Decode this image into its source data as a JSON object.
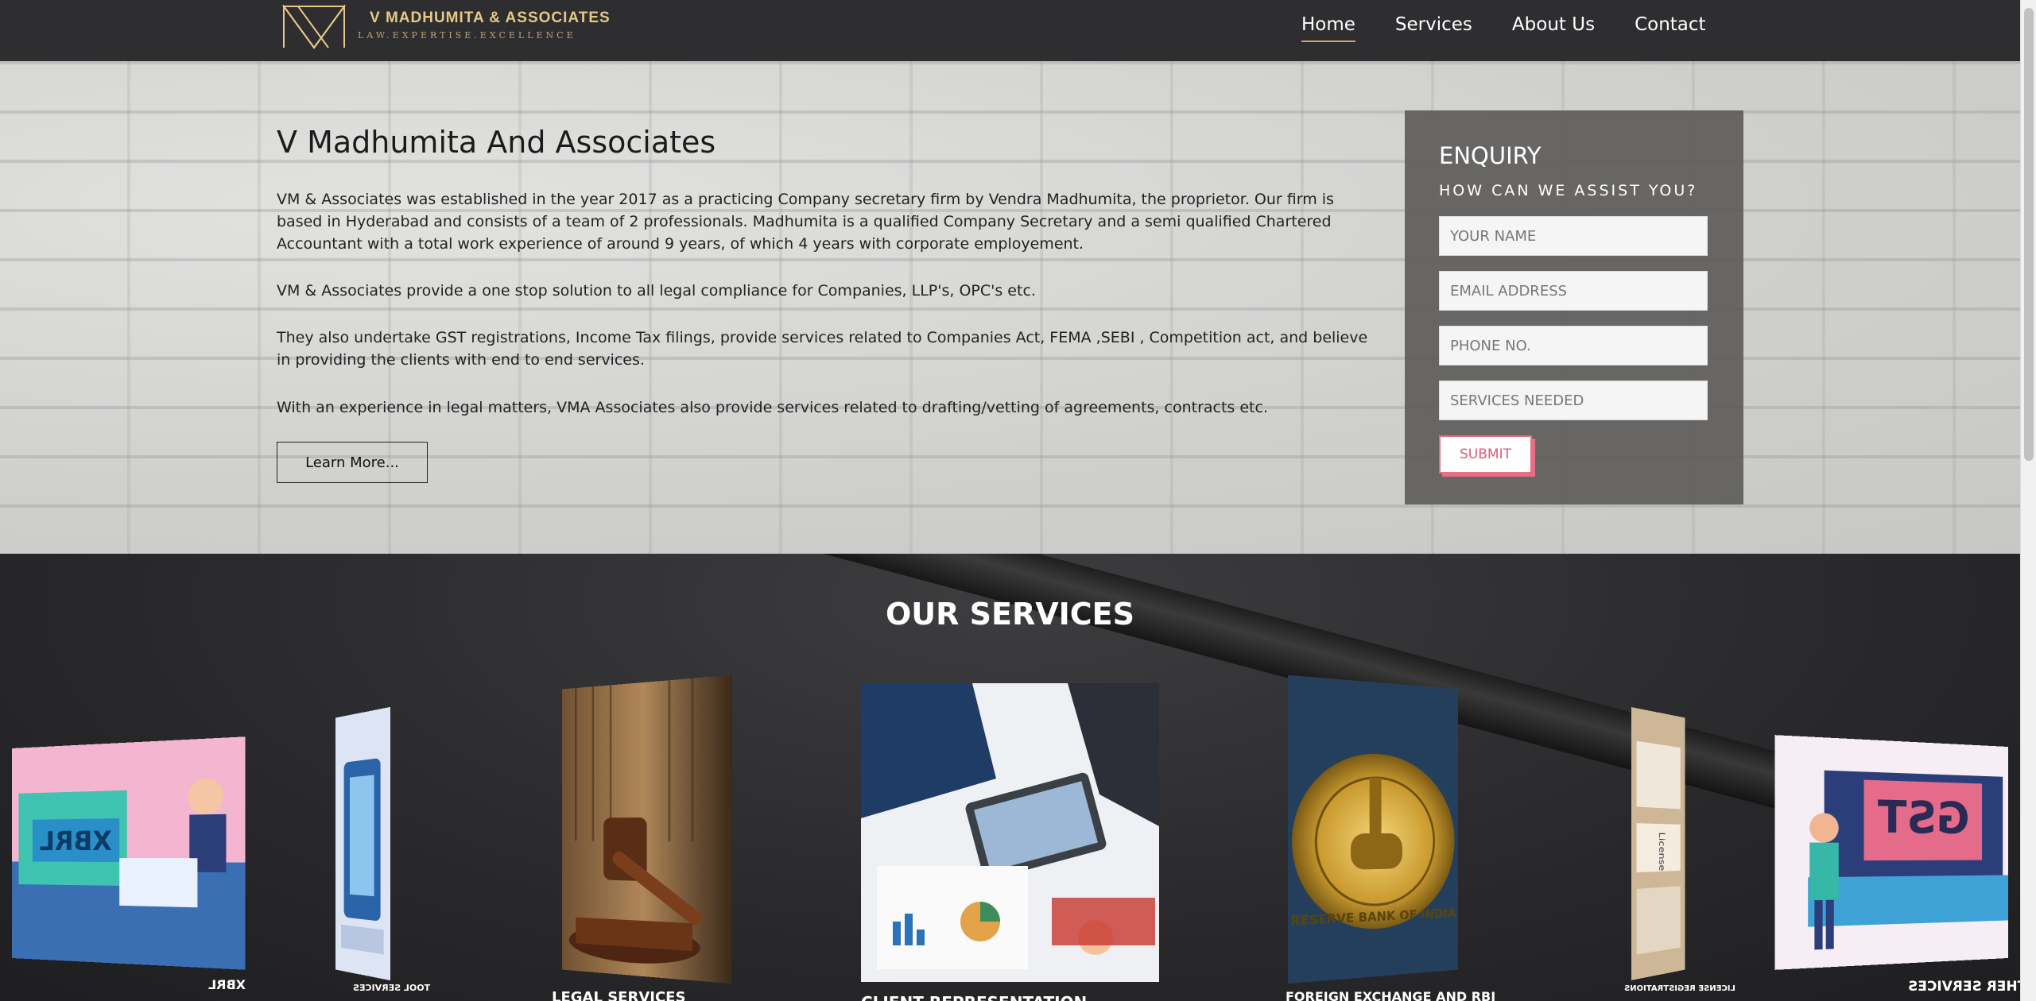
{
  "header": {
    "brand_title": "V MADHUMITA & ASSOCIATES",
    "brand_tagline": "LAW.EXPERTISE.EXCELLENCE",
    "nav": [
      {
        "label": "Home",
        "active": true
      },
      {
        "label": "Services",
        "active": false
      },
      {
        "label": "About Us",
        "active": false
      },
      {
        "label": "Contact",
        "active": false
      }
    ]
  },
  "hero": {
    "title": "V Madhumita And Associates",
    "paragraphs": [
      "VM & Associates was established in the year 2017 as a practicing Company secretary firm by Vendra Madhumita, the proprietor. Our firm is based in Hyderabad and consists of a team of 2 professionals. Madhumita is a qualified Company Secretary and a semi qualified Chartered Accountant with a total work experience of around 9 years, of which 4 years with corporate employement.",
      "VM & Associates provide a one stop solution to all legal compliance for Companies, LLP's, OPC's etc.",
      "They also undertake GST registrations, Income Tax filings, provide services related to Companies Act, FEMA ,SEBI , Competition act, and believe in providing the clients with end to end services.",
      "With an experience in legal matters, VMA Associates also provide services related to drafting/vetting of agreements, contracts etc."
    ],
    "learn_more_label": "Learn More..."
  },
  "enquiry": {
    "title": "ENQUIRY",
    "subtitle": "HOW CAN WE ASSIST YOU?",
    "fields": [
      {
        "placeholder": "YOUR NAME"
      },
      {
        "placeholder": "EMAIL ADDRESS"
      },
      {
        "placeholder": "PHONE NO."
      },
      {
        "placeholder": "SERVICES NEEDED"
      }
    ],
    "submit_label": "SUBMIT"
  },
  "services": {
    "heading": "OUR SERVICES",
    "cards": [
      {
        "caption": "XBRL",
        "image": "xbrl-illustration"
      },
      {
        "caption": "TOOL SERVICES",
        "image": "device-illustration"
      },
      {
        "caption": "LEGAL SERVICES",
        "image": "gavel-photo"
      },
      {
        "caption": "CLIENT REPRESENTATION",
        "image": "business-meeting-photo"
      },
      {
        "caption": "FOREIGN EXCHANGE AND RBI",
        "image": "rbi-seal-photo"
      },
      {
        "caption": "LICENSE REGISTRATIONS",
        "image": "license-photo"
      },
      {
        "caption": "OTHER SERVICES",
        "image": "gst-illustration"
      }
    ],
    "rbi_seal_text": "RESERVE BANK OF INDIA",
    "gst_text": "GST",
    "xbrl_text": "XBRL",
    "license_text": "License"
  },
  "colors": {
    "header_bg": "#2e2d30",
    "brand_gold": "#e6c987",
    "nav_active_underline": "#d6a75a",
    "enquiry_bg": "#5f5e5c",
    "submit_accent": "#e66d84"
  }
}
